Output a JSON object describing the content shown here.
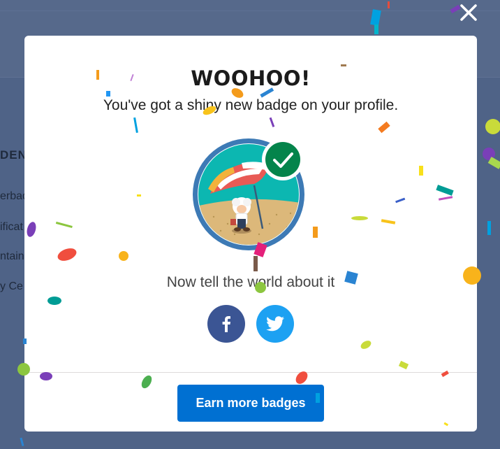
{
  "background": {
    "sidebar_heading": "DEN",
    "sidebar_items": [
      "erbad",
      "ificat",
      "ntain",
      "y Ce"
    ]
  },
  "modal": {
    "title": "WOOHOO!",
    "subtitle": "You've got a shiny new badge on your profile.",
    "share_prompt": "Now tell the world about it",
    "cta_label": "Earn more badges"
  },
  "icons": {
    "close": "close-icon",
    "facebook": "facebook-icon",
    "twitter": "twitter-icon",
    "badge": "badge-image",
    "check": "checkmark-icon"
  },
  "colors": {
    "overlay": "#4f6387",
    "modal_bg": "#ffffff",
    "cta": "#0070d2",
    "facebook": "#3b5594",
    "twitter": "#1da1f2",
    "badge_check": "#04844b",
    "badge_ring": "#3d7ab5"
  }
}
